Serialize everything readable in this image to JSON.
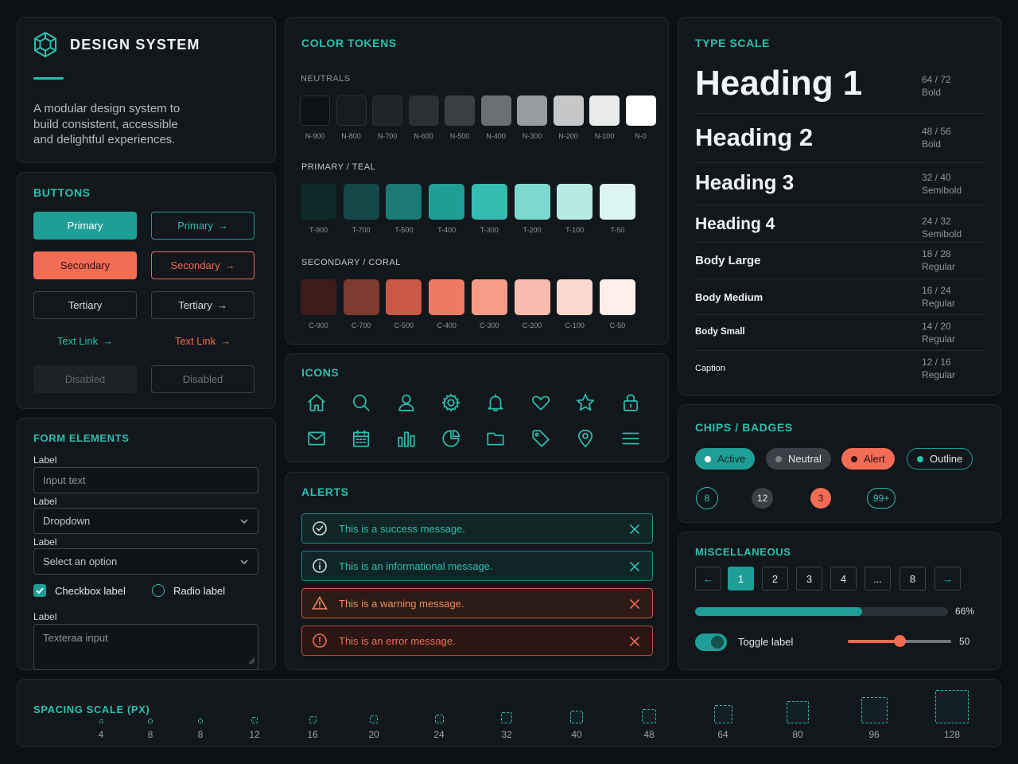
{
  "brand": {
    "title": "DESIGN SYSTEM",
    "description": "A modular design system to build consistent, accessible and delightful experiences."
  },
  "buttons": {
    "title": "BUTTONS",
    "primary": "Primary",
    "primary_outline": "Primary",
    "secondary": "Secondary",
    "secondary_outline": "Secondary",
    "tertiary": "Tertiary",
    "tertiary_outline": "Tertiary",
    "link_teal": "Text Link",
    "link_coral": "Text Link",
    "disabled": "Disabled",
    "disabled_outline": "Disabled"
  },
  "form": {
    "title": "FORM ELEMENTS",
    "label1": "Label",
    "input_placeholder": "Input text",
    "label2": "Label",
    "dropdown": "Dropdown",
    "label3": "Label",
    "select": "Select an option",
    "checkbox_label": "Checkbox label",
    "radio_label": "Radio label",
    "label4": "Label",
    "textarea_placeholder": "Texteraa input"
  },
  "colors": {
    "title": "COLOR TOKENS",
    "neutrals": {
      "title": "NEUTRALS",
      "swatches": [
        {
          "name": "N-900",
          "color": "#0e1215"
        },
        {
          "name": "N-800",
          "color": "#171c20"
        },
        {
          "name": "N-700",
          "color": "#1f2428"
        },
        {
          "name": "N-600",
          "color": "#2b3034"
        },
        {
          "name": "N-500",
          "color": "#3a3f43"
        },
        {
          "name": "N-400",
          "color": "#6b6f72"
        },
        {
          "name": "N-300",
          "color": "#999c9e"
        },
        {
          "name": "N-200",
          "color": "#c5c7c8"
        },
        {
          "name": "N-100",
          "color": "#eaebeb"
        },
        {
          "name": "N-0",
          "color": "#ffffff"
        }
      ]
    },
    "teal": {
      "title": "PRIMARY / TEAL",
      "swatches": [
        {
          "name": "T-900",
          "color": "#0d2a29"
        },
        {
          "name": "T-700",
          "color": "#154845"
        },
        {
          "name": "T-500",
          "color": "#1b7a74"
        },
        {
          "name": "T-400",
          "color": "#1f9e96"
        },
        {
          "name": "T-300",
          "color": "#33bdb1"
        },
        {
          "name": "T-200",
          "color": "#7dd8cf"
        },
        {
          "name": "T-100",
          "color": "#b6ebe5"
        },
        {
          "name": "T-50",
          "color": "#dcf5f2"
        }
      ]
    },
    "coral": {
      "title": "SECONDARY / CORAL",
      "swatches": [
        {
          "name": "C-900",
          "color": "#3a1c19"
        },
        {
          "name": "C-700",
          "color": "#7c3a31"
        },
        {
          "name": "C-500",
          "color": "#c85947"
        },
        {
          "name": "C-400",
          "color": "#ef7a63"
        },
        {
          "name": "C-300",
          "color": "#f49c87"
        },
        {
          "name": "C-200",
          "color": "#f7bcae"
        },
        {
          "name": "C-100",
          "color": "#fad8cf"
        },
        {
          "name": "C-50",
          "color": "#fdeeea"
        }
      ]
    }
  },
  "icons": {
    "title": "ICONS",
    "items": [
      "home-icon",
      "search-icon",
      "user-icon",
      "gear-icon",
      "bell-icon",
      "heart-icon",
      "star-icon",
      "lock-icon",
      "mail-icon",
      "calendar-icon",
      "bar-chart-icon",
      "pie-chart-icon",
      "folder-icon",
      "tag-icon",
      "map-pin-icon",
      "menu-icon"
    ]
  },
  "alerts": {
    "title": "ALERTS",
    "items": [
      {
        "type": "success",
        "text": "This is a success message.",
        "color": "#2bbfb0"
      },
      {
        "type": "info",
        "text": "This is an informational message.",
        "color": "#2bbfb0"
      },
      {
        "type": "warning",
        "text": "This is a warning message.",
        "color": "#f08a5d"
      },
      {
        "type": "error",
        "text": "This is an error message.",
        "color": "#f26b55"
      }
    ]
  },
  "type": {
    "title": "TYPE SCALE",
    "items": [
      {
        "name": "Heading 1",
        "size": "64 / 72",
        "weight": "Bold"
      },
      {
        "name": "Heading 2",
        "size": "48 / 56",
        "weight": "Bold"
      },
      {
        "name": "Heading 3",
        "size": "32 / 40",
        "weight": "Semibold"
      },
      {
        "name": "Heading 4",
        "size": "24 / 32",
        "weight": "Semibold"
      },
      {
        "name": "Body Large",
        "size": "18 / 28",
        "weight": "Regular"
      },
      {
        "name": "Body Medium",
        "size": "16 / 24",
        "weight": "Regular"
      },
      {
        "name": "Body Small",
        "size": "14 / 20",
        "weight": "Regular"
      },
      {
        "name": "Caption",
        "size": "12 / 16",
        "weight": "Regular"
      }
    ]
  },
  "chips": {
    "title": "CHIPS / BADGES",
    "active": "Active",
    "neutral": "Neutral",
    "alert": "Alert",
    "outline": "Outline",
    "badges": [
      "8",
      "12",
      "3",
      "99+"
    ]
  },
  "misc": {
    "title": "MISCELLANEOUS",
    "pages": [
      "1",
      "2",
      "3",
      "4",
      "...",
      "8"
    ],
    "current_page": "1",
    "progress": 0.66,
    "progress_label": "66%",
    "toggle_label": "Toggle label",
    "toggle_on": true,
    "slider_value": 50,
    "slider_label": "50"
  },
  "spacing": {
    "title": "SPACING SCALE (PX)",
    "values": [
      "4",
      "8",
      "8",
      "12",
      "16",
      "20",
      "24",
      "32",
      "40",
      "48",
      "64",
      "80",
      "96",
      "128"
    ]
  },
  "accent_teal": "#2bbfb0",
  "accent_coral": "#f26b55"
}
